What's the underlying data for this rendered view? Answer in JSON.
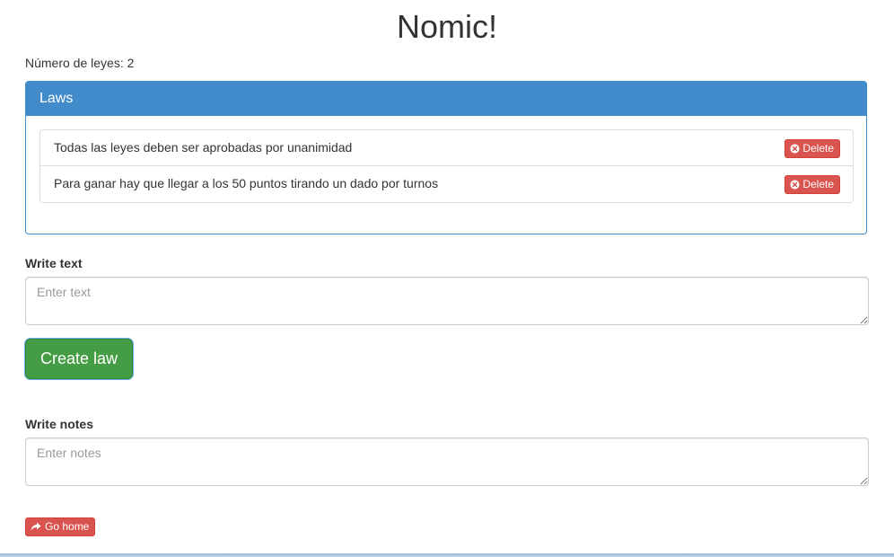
{
  "page": {
    "title": "Nomic!",
    "law_count_text": "Número de leyes: 2"
  },
  "laws_panel": {
    "heading": "Laws",
    "items": [
      {
        "text": "Todas las leyes deben ser aprobadas por unanimidad",
        "delete_label": "Delete"
      },
      {
        "text": "Para ganar hay que llegar a los 50 puntos tirando un dado por turnos",
        "delete_label": "Delete"
      }
    ]
  },
  "law_form": {
    "label": "Write text",
    "value": "",
    "placeholder": "Enter text",
    "submit_label": "Create law"
  },
  "notes_form": {
    "label": "Write notes",
    "value": "",
    "placeholder": "Enter notes"
  },
  "footer": {
    "home_label": "Go home"
  },
  "icons": {
    "delete": "remove-circle-icon",
    "home": "share-arrow-icon"
  },
  "colors": {
    "primary": "#428bca",
    "danger": "#d9534f",
    "success": "#449d44"
  }
}
